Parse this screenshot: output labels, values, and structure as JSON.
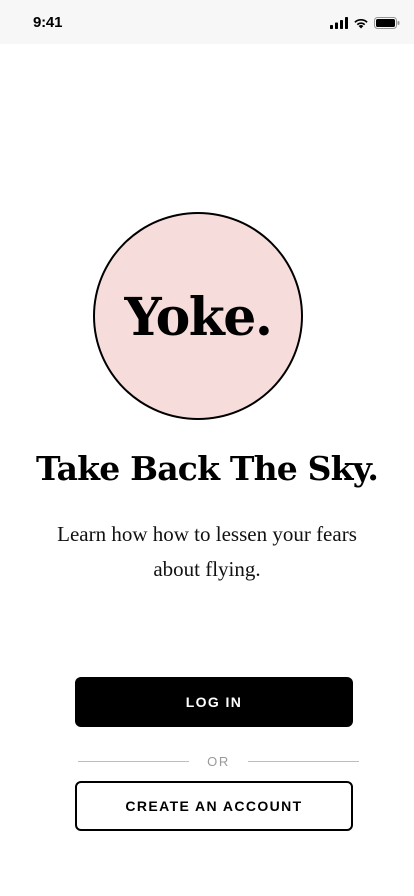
{
  "status_bar": {
    "time": "9:41",
    "icons": [
      "cellular-signal-icon",
      "wifi-icon",
      "battery-icon"
    ]
  },
  "logo": {
    "text": "Yoke.",
    "circle_color": "#f7dcdc"
  },
  "headline": "Take Back The Sky.",
  "tagline": "Learn how how to lessen your fears about flying.",
  "actions": {
    "login_label": "LOG IN",
    "divider_label": "OR",
    "create_account_label": "CREATE AN ACCOUNT"
  },
  "colors": {
    "primary": "#000000",
    "background": "#ffffff",
    "accent_pink": "#f7dcdc",
    "muted": "#9a9a9a"
  }
}
